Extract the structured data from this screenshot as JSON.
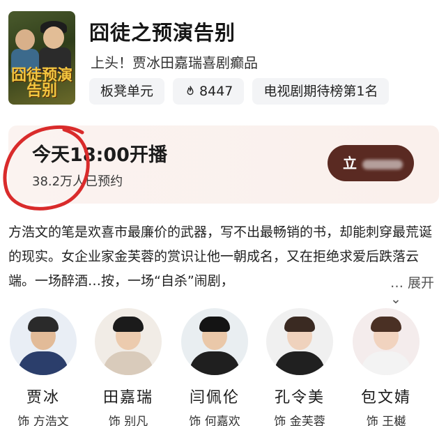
{
  "show": {
    "title": "囧徒之预演告别",
    "subtitle": "上头！贾冰田嘉瑞喜剧癫品",
    "poster_title": "囧徒预演告别"
  },
  "tags": [
    {
      "label": "板凳单元",
      "icon": ""
    },
    {
      "label": "8447",
      "icon": "flame-icon"
    },
    {
      "label": "电视剧期待榜第1名",
      "icon": ""
    }
  ],
  "reservation": {
    "time_text": "今天18:00开播",
    "count_text": "38.2万人已预约",
    "button_label": "立"
  },
  "description": {
    "text": "方浩文的笔是欢喜市最廉价的武器，写不出最畅销的书，却能刺穿最荒诞的现实。女企业家金芙蓉的赏识让他一朝成名，又在拒绝求爱后跌落云端。一场醉酒…按，一场“自杀”闹剧，",
    "ellipsis": "…",
    "expand_label": "展开"
  },
  "cast": [
    {
      "name": "贾冰",
      "role": "饰 方浩文",
      "colors": {
        "bg": "#e9eef5",
        "torso": "#2b3e6b",
        "hair": "#2a2a2a",
        "skin": "#e2bb98"
      }
    },
    {
      "name": "田嘉瑞",
      "role": "饰 别凡",
      "colors": {
        "bg": "#f1ece6",
        "torso": "#d9cbbb",
        "hair": "#1b1b1b",
        "skin": "#eccbae"
      }
    },
    {
      "name": "闫佩伦",
      "role": "饰 何嘉欢",
      "colors": {
        "bg": "#e9eef1",
        "torso": "#1f1f1f",
        "hair": "#141414",
        "skin": "#eac8a9"
      }
    },
    {
      "name": "孔令美",
      "role": "饰 金芙蓉",
      "colors": {
        "bg": "#f0f0f0",
        "torso": "#202020",
        "hair": "#3a2a22",
        "skin": "#efd2bd"
      }
    },
    {
      "name": "包文婧",
      "role": "饰 王樾",
      "colors": {
        "bg": "#f4ecec",
        "torso": "#f3f3f3",
        "hair": "#4a3024",
        "skin": "#f1d3bf"
      }
    }
  ],
  "accent_colors": {
    "button_bg": "#5a2a22",
    "banner_bg": "#fbf3f0",
    "annotation_red": "#d92b2b"
  }
}
